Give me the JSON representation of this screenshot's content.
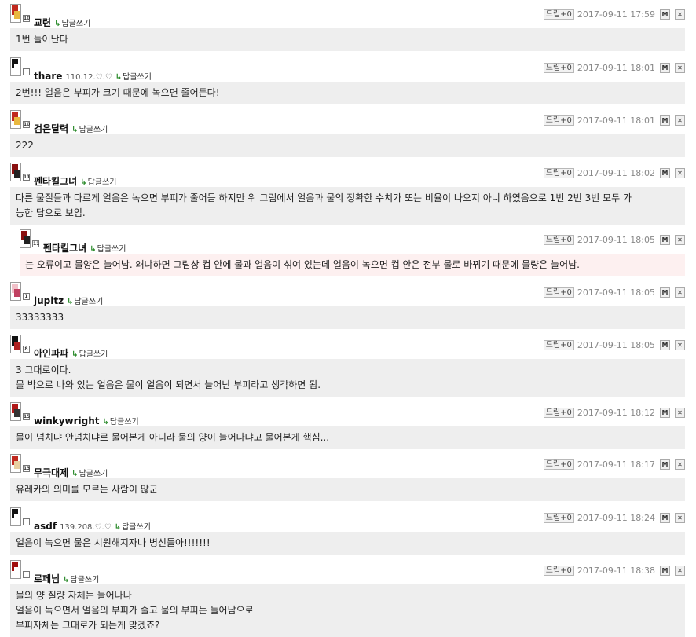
{
  "colors": {
    "body_bg": "#eeeeee",
    "reply_body_bg": "#fdf0f0",
    "reply_arrow": "#2a8a2a"
  },
  "reply_label": "답글쓰기",
  "drip_label": "드립+0",
  "icons": {
    "reply_arrow": "reply-arrow-icon",
    "memo": "memo-icon",
    "delete": "delete-icon",
    "memo_glyph": "M",
    "delete_glyph": "✕"
  },
  "comments": [
    {
      "nick": "교련",
      "ip": "",
      "level": "10",
      "date": "2017-09-11 17:59",
      "text": "1번 늘어난다"
    },
    {
      "nick": "thare",
      "ip": "110.12.♡.♡",
      "level": "",
      "date": "2017-09-11 18:01",
      "text": "2번!!! 얼음은 부피가 크기 때문에 녹으면 줄어든다!"
    },
    {
      "nick": "검은달력",
      "ip": "",
      "level": "10",
      "date": "2017-09-11 18:01",
      "text": "222"
    },
    {
      "nick": "펜타킬그녀",
      "ip": "",
      "level": "11",
      "date": "2017-09-11 18:02",
      "text": "다른 물질들과 다르게 얼음은 녹으면 부피가 줄어듬 하지만 위 그림에서 얼음과 물의 정확한 수치가 또는 비율이 나오지 아니 하였음으로 1번 2번 3번 모두 가\n능한 답으로 보임."
    },
    {
      "nick": "펜타킬그녀",
      "ip": "",
      "level": "11",
      "date": "2017-09-11 18:05",
      "text": "는 오류이고 물양은 늘어남. 왜냐하면 그림상 컵 안에 물과 얼음이 섞여 있는데 얼음이 녹으면 컵 안은 전부 물로 바뀌기 때문에 물량은 늘어남."
    },
    {
      "nick": "jupitz",
      "ip": "",
      "level": "1",
      "date": "2017-09-11 18:05",
      "text": "33333333"
    },
    {
      "nick": "아인파파",
      "ip": "",
      "level": "8",
      "date": "2017-09-11 18:05",
      "text": "3 그대로이다.\n물 밖으로 나와 있는 얼음은 물이 얼음이 되면서 늘어난 부피라고 생각하면 됨."
    },
    {
      "nick": "winkywright",
      "ip": "",
      "level": "15",
      "date": "2017-09-11 18:12",
      "text": "물이 넘치냐 안넘치냐로 물어본게 아니라 물의 양이 늘어나냐고 물어본게 핵심..."
    },
    {
      "nick": "무극대제",
      "ip": "",
      "level": "13",
      "date": "2017-09-11 18:17",
      "text": "유레카의 의미를 모르는 사람이 많군"
    },
    {
      "nick": "asdf",
      "ip": "139.208.♡.♡",
      "level": "",
      "date": "2017-09-11 18:24",
      "text": "얼음이 녹으면 물은 시원해지자나 병신들아!!!!!!!"
    },
    {
      "nick": "로페님",
      "ip": "",
      "level": "",
      "date": "2017-09-11 18:38",
      "text": "물의 양 질량 자체는 늘어나나\n얼음이 녹으면서 얼음의 부피가 줄고 물의 부피는 늘어남으로\n부피자체는 그대로가 되는게 맞겠죠?"
    }
  ]
}
